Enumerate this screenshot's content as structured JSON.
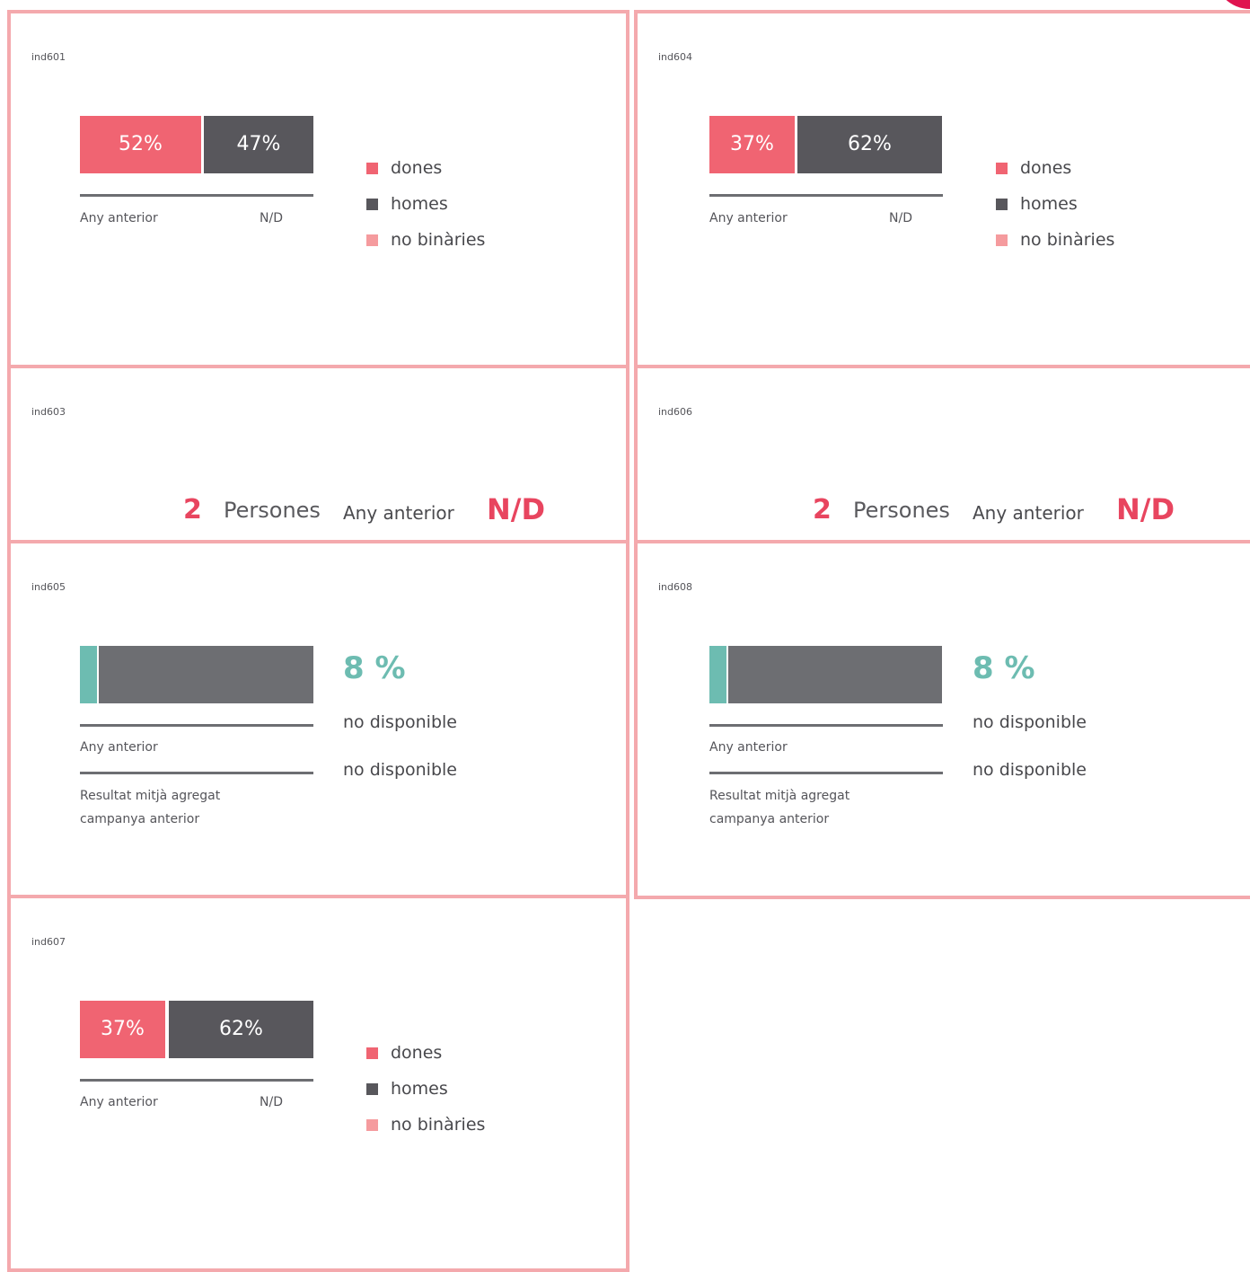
{
  "legend": {
    "women": "dones",
    "men": "homes",
    "nonbinary": "no binàries"
  },
  "common": {
    "prev_year": "Any anterior",
    "nd": "N/D",
    "persons": "Persones",
    "not_available": "no disponible",
    "aggregate_line1": "Resultat mitjà agregat",
    "aggregate_line2": "campanya anterior"
  },
  "ind601": {
    "id": "ind601",
    "women_pct": 52,
    "men_pct": 47,
    "women_label": "52%",
    "men_label": "47%",
    "prev": "N/D"
  },
  "ind604": {
    "id": "ind604",
    "women_pct": 37,
    "men_pct": 62,
    "women_label": "37%",
    "men_label": "62%",
    "prev": "N/D"
  },
  "ind607": {
    "id": "ind607",
    "women_pct": 37,
    "men_pct": 62,
    "women_label": "37%",
    "men_label": "62%",
    "prev": "N/D"
  },
  "ind603": {
    "id": "ind603",
    "count": "2",
    "prev": "N/D"
  },
  "ind606": {
    "id": "ind606",
    "count": "2",
    "prev": "N/D"
  },
  "ind605": {
    "id": "ind605",
    "value_pct": 8,
    "value_label": "8 %",
    "prev_value": "no disponible",
    "aggregate_value": "no disponible"
  },
  "ind608": {
    "id": "ind608",
    "value_pct": 8,
    "value_label": "8 %",
    "prev_value": "no disponible",
    "aggregate_value": "no disponible"
  },
  "colors": {
    "border": "#f4a9ad",
    "women": "#f06472",
    "men": "#58575c",
    "nonbinary": "#f59b9e",
    "accent": "#6dbcb1",
    "highlight": "#e8455f"
  }
}
